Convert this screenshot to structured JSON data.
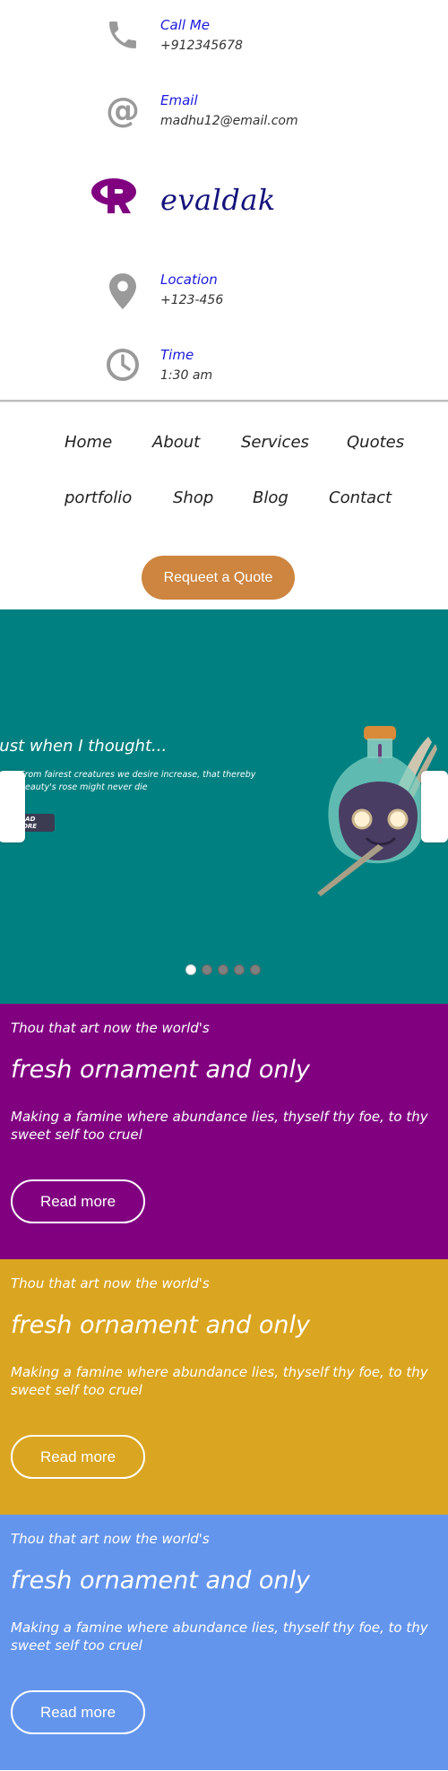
{
  "contact": {
    "phone": {
      "label": "Call Me",
      "value": "+912345678"
    },
    "email": {
      "label": "Email",
      "value": "madhu12@email.com"
    },
    "logo": {
      "text": "evaldak",
      "color": "#800080"
    },
    "location": {
      "label": "Location",
      "value": "+123-456"
    },
    "time": {
      "label": "Time",
      "value": "1:30 am"
    }
  },
  "nav": {
    "items": [
      "Home",
      "About",
      "Services",
      "Quotes",
      "portfolio",
      "Shop",
      "Blog",
      "Contact"
    ],
    "quote_button": "Requeet a Quote"
  },
  "slider": {
    "title": "Just when I thought...",
    "text": "From fairest creatures we desire increase, that thereby beauty's rose might never die",
    "button": "READ MORE",
    "background": "#008080",
    "slide_count": 5,
    "active_slide": 1
  },
  "panels": [
    {
      "kicker": "Thou that art now the world's",
      "title": "fresh ornament and only",
      "body": "Making a famine where abundance lies, thyself thy foe, to thy sweet self too cruel",
      "button": "Read more",
      "color": "#800080"
    },
    {
      "kicker": "Thou that art now the world's",
      "title": "fresh ornament and only",
      "body": "Making a famine where abundance lies, thyself thy foe, to thy sweet self too cruel",
      "button": "Read more",
      "color": "#daa520"
    },
    {
      "kicker": "Thou that art now the world's",
      "title": "fresh ornament and only",
      "body": "Making a famine where abundance lies, thyself thy foe, to thy sweet self too cruel",
      "button": "Read more",
      "color": "#6495ed"
    }
  ]
}
